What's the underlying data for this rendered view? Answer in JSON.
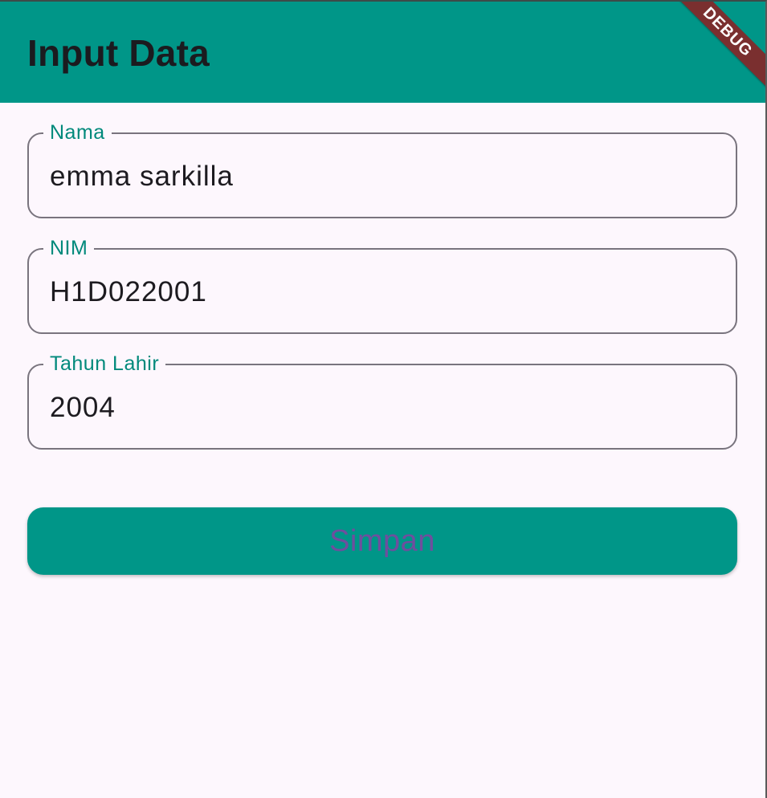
{
  "app_bar": {
    "title": "Input Data",
    "debug_banner": "DEBUG",
    "background_color": "#009688"
  },
  "form": {
    "fields": [
      {
        "label": "Nama",
        "value": "emma sarkilla"
      },
      {
        "label": "NIM",
        "value": "H1D022001"
      },
      {
        "label": "Tahun Lahir",
        "value": "2004"
      }
    ],
    "submit_label": "Simpan",
    "accent_color": "#00897b",
    "button_text_color": "#6f4e9e"
  }
}
